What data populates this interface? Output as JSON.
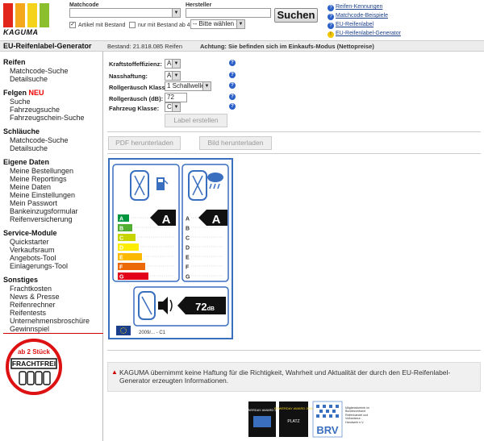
{
  "logo": {
    "text": "KAGUMA",
    "colors": [
      "#e3261c",
      "#f5a81c",
      "#f5d21c",
      "#8bbf2e"
    ]
  },
  "search": {
    "matchcode_label": "Matchcode",
    "hersteller_label": "Hersteller",
    "hersteller_value": "-- Bitte wählen --",
    "artikel_bestand_label": "Artikel mit Bestand",
    "bestand_ab4_label": "nur mit Bestand ab 4",
    "suchen_button": "Suchen"
  },
  "header_links": [
    {
      "label": "Reifen-Kennungen",
      "icon": "question-icon"
    },
    {
      "label": "Matchcode-Beispiele",
      "icon": "question-icon"
    },
    {
      "label": "EU-Reifenlabel",
      "icon": "question-icon"
    },
    {
      "label": "EU-Reifenlabel-Generator",
      "icon": "warning-icon"
    }
  ],
  "bar": {
    "title": "EU-Reifenlabel-Generator",
    "bestand": "Bestand: 21.818.085 Reifen",
    "achtung": "Achtung: Sie befinden sich im Einkaufs-Modus (Nettopreise)"
  },
  "sidebar": {
    "reifen": {
      "title": "Reifen",
      "items": [
        "Matchcode-Suche",
        "Detailsuche"
      ]
    },
    "felgen": {
      "title": "Felgen",
      "badge": "NEU",
      "items": [
        "Suche",
        "Fahrzeugsuche",
        "Fahrzeugschein-Suche"
      ]
    },
    "schlaeuche": {
      "title": "Schläuche",
      "items": [
        "Matchcode-Suche",
        "Detailsuche"
      ]
    },
    "eigene": {
      "title": "Eigene Daten",
      "items": [
        "Meine Bestellungen",
        "Meine Reportings",
        "Meine Daten",
        "Meine Einstellungen",
        "Mein Passwort",
        "Bankeinzugsformular",
        "Reifenversicherung"
      ]
    },
    "service": {
      "title": "Service-Module",
      "items": [
        "Quickstarter",
        "Verkaufsraum",
        "Angebots-Tool",
        "Einlagerungs-Tool"
      ]
    },
    "sonstiges": {
      "title": "Sonstiges",
      "items": [
        "Frachtkosten",
        "News & Presse",
        "Reifenrechner",
        "Reifentests",
        "Unternehmensbroschüre",
        "Gewinnspiel"
      ]
    },
    "stamp": {
      "top": "ab 2 Stück",
      "main": "FRACHTFREI"
    }
  },
  "form": {
    "kraftstoff": {
      "label": "Kraftstoffeffizienz:",
      "value": "A"
    },
    "nasshaftung": {
      "label": "Nasshaftung:",
      "value": "A"
    },
    "rollgeraeusch_klasse": {
      "label": "Rollgeräusch Klasse:",
      "value": "1 Schallwelle"
    },
    "rollgeraeusch_db": {
      "label": "Rollgeräusch (dB):",
      "value": "72"
    },
    "fahrzeug_klasse": {
      "label": "Fahrzeug Klasse:",
      "value": "C1"
    },
    "label_button": "Label erstellen",
    "pdf_button": "PDF herunterladen",
    "bild_button": "Bild herunterladen"
  },
  "tyre_label": {
    "fuel_rating": "A",
    "wet_rating": "A",
    "grades": [
      "A",
      "B",
      "C",
      "D",
      "E",
      "F",
      "G"
    ],
    "grade_colors": [
      "#009640",
      "#52ae32",
      "#c8d400",
      "#ffed00",
      "#fbba00",
      "#eb6909",
      "#e2001a"
    ],
    "noise": "72",
    "noise_unit": "dB",
    "footer": "2009/... - C1"
  },
  "disclaimer": "KAGUMA übernimmt keine Haftung für die Richtigkeit, Wahrheit und Aktualität der durch den EU-Reifenlabel-Generator erzeugten Informationen.",
  "footer": {
    "award1": "POWERDAY AWARD 2015",
    "award2": "PLATZ",
    "brv": "BRV",
    "brv_text": "Mitgliedsbetrieb im Bundesverband Reifenhandel und Vulkaniseur-Handwerk e.V."
  }
}
